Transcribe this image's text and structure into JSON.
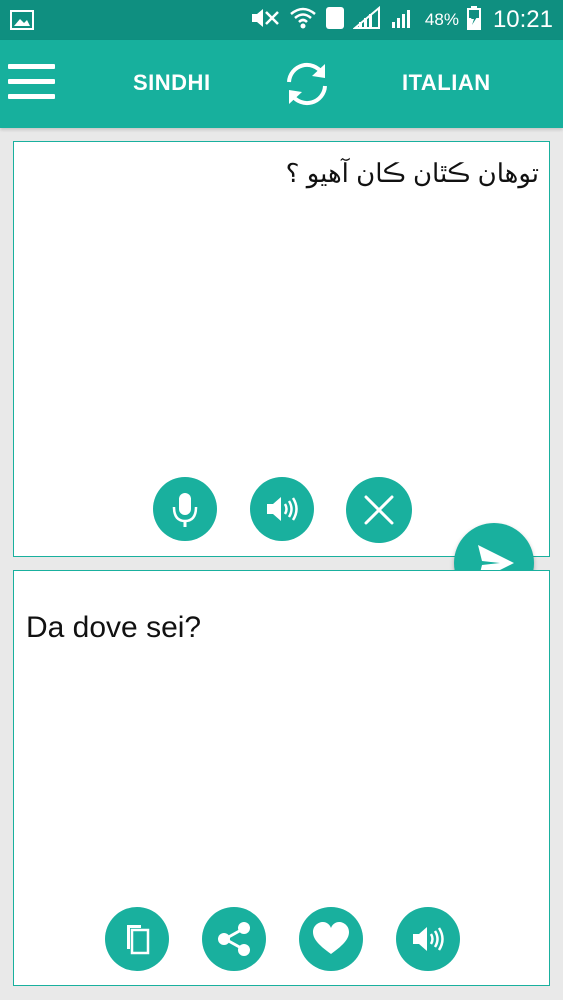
{
  "status_bar": {
    "battery_percent": "48%",
    "time": "10:21",
    "sim_slot": "1"
  },
  "toolbar": {
    "source_language": "SINDHI",
    "target_language": "ITALIAN"
  },
  "source_panel": {
    "text": "توهان ڪٿان ڪان آهيو ؟"
  },
  "target_panel": {
    "text": "Da dove sei?"
  },
  "icons": [
    "image-icon",
    "mute-icon",
    "wifi-icon",
    "signal-icon",
    "battery-icon",
    "menu-icon",
    "swap-icon",
    "microphone-icon",
    "speaker-icon",
    "close-icon",
    "send-icon",
    "copy-icon",
    "share-icon",
    "heart-icon"
  ],
  "colors": {
    "status_bar": "#0f8f80",
    "accent": "#17b09d",
    "background": "#e9e9e9",
    "panel": "#ffffff"
  }
}
